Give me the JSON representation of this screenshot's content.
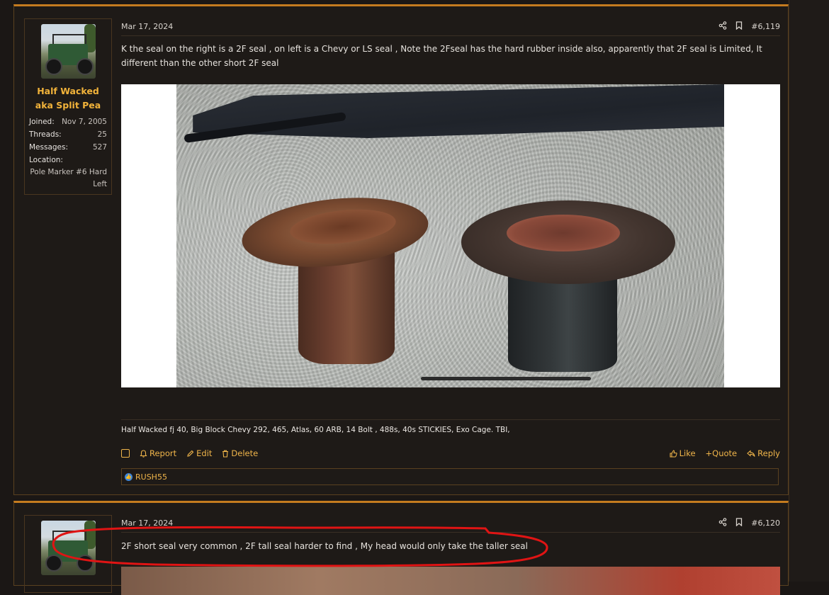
{
  "posts": [
    {
      "user": {
        "name": "Half Wacked aka Split Pea",
        "stats": [
          {
            "label": "Joined:",
            "value": "Nov 7, 2005"
          },
          {
            "label": "Threads:",
            "value": "25"
          },
          {
            "label": "Messages:",
            "value": "527"
          }
        ],
        "location_label": "Location:",
        "location": "Pole Marker #6 Hard Left"
      },
      "date": "Mar 17, 2024",
      "post_number": "#6,119",
      "text": "K the seal on the right is a 2F seal , on left is a Chevy or LS seal , Note the 2Fseal has the hard rubber inside also, apparently that 2F seal is Limited, It different than the other short 2F seal",
      "signature": "Half Wacked fj 40, Big Block Chevy 292, 465, Atlas, 60 ARB, 14 Bolt , 488s, 40s STICKIES, Exo Cage. TBI,",
      "actions_left": {
        "report": "Report",
        "edit": "Edit",
        "delete": "Delete"
      },
      "actions_right": {
        "like": "Like",
        "quote": "+Quote",
        "reply": "Reply"
      },
      "reaction_user": "RUSH55"
    },
    {
      "date": "Mar 17, 2024",
      "post_number": "#6,120",
      "text": "2F short seal very common , 2F tall seal harder to find , My head would only take the taller seal"
    }
  ],
  "icons": {
    "share": "share-icon",
    "bookmark": "bookmark-icon",
    "report": "bell-icon",
    "edit": "pencil-icon",
    "delete": "trash-icon",
    "like": "thumbs-up-icon",
    "reply": "reply-icon"
  },
  "colors": {
    "accent": "#f0b54a",
    "username": "#f2b33a",
    "post_border_top": "#c47b1f",
    "annotation": "#e01414"
  }
}
